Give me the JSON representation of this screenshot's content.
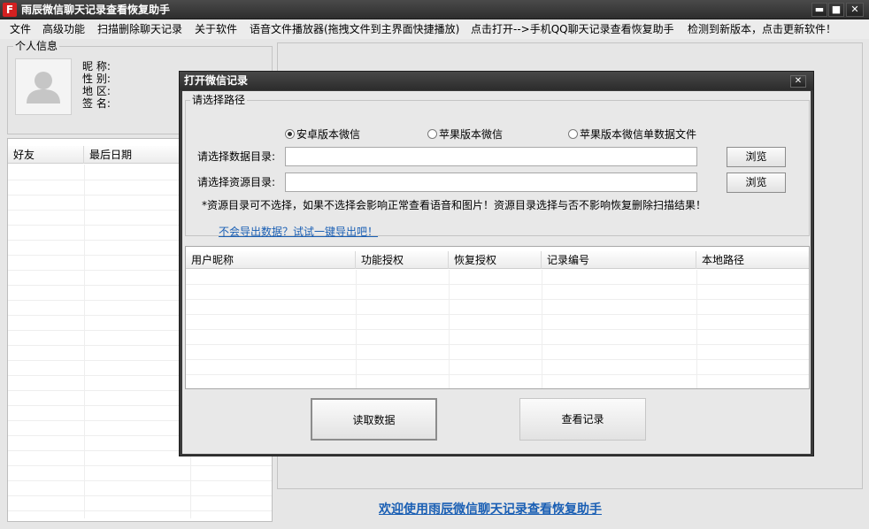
{
  "window": {
    "app_icon_glyph": "F",
    "title": "雨辰微信聊天记录查看恢复助手",
    "minimize_glyph": "▬",
    "maximize_glyph": "■",
    "close_glyph": "✕"
  },
  "menu": [
    "文件",
    "高级功能",
    "扫描删除聊天记录",
    "关于软件",
    "语音文件播放器(拖拽文件到主界面快捷播放)",
    "点击打开-->手机QQ聊天记录查看恢复助手",
    "检测到新版本，点击更新软件！"
  ],
  "profile": {
    "caption": "个人信息",
    "labels": [
      "昵 称:",
      "性 别:",
      "地 区:",
      "签 名:"
    ]
  },
  "friends": {
    "columns": [
      "好友",
      "最后日期"
    ]
  },
  "footer_link": "欢迎使用雨辰微信聊天记录查看恢复助手",
  "dialog": {
    "title": "打开微信记录",
    "close_glyph": "✕",
    "group_caption": "请选择路径",
    "radios": [
      {
        "label": "安卓版本微信",
        "checked": true
      },
      {
        "label": "苹果版本微信",
        "checked": false
      },
      {
        "label": "苹果版本微信单数据文件",
        "checked": false
      }
    ],
    "data_dir_label": "请选择数据目录:",
    "data_dir_value": "",
    "res_dir_label": "请选择资源目录:",
    "res_dir_value": "",
    "browse_label": "浏览",
    "note": "*资源目录可不选择，如果不选择会影响正常查看语音和图片！资源目录选择与否不影响恢复删除扫描结果！",
    "export_link": "不会导出数据？试试一键导出吧！",
    "table_columns": [
      "用户昵称",
      "功能授权",
      "恢复授权",
      "记录编号",
      "本地路径"
    ],
    "read_button": "读取数据",
    "view_button": "查看记录"
  },
  "colors": {
    "title_bar": "#2e2e2e",
    "link": "#1a5fb4",
    "client_bg": "#e6e6e6"
  }
}
